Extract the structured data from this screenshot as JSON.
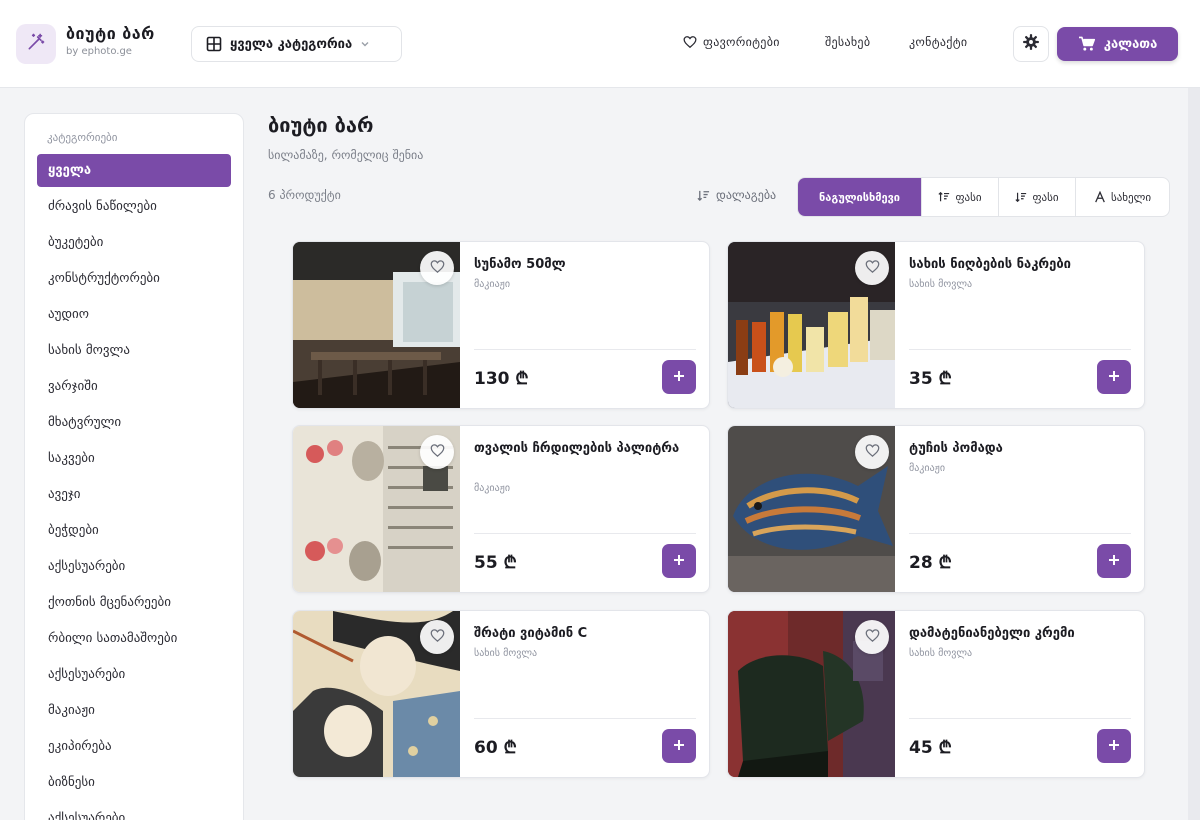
{
  "header": {
    "logo_icon": "magic-wand-icon",
    "title": "ბიუტი ბარ",
    "subtitle": "by ephoto.ge",
    "category_select": "ყველა კატეგორია",
    "nav": {
      "favorites": "ფავორიტები",
      "about": "შესახებ",
      "contact": "კონტაქტი"
    },
    "cart_label": "კალათა"
  },
  "sidebar": {
    "heading": "კატეგორიები",
    "items": [
      {
        "label": "ყველა",
        "active": true
      },
      {
        "label": "ძრავის ნაწილები"
      },
      {
        "label": "ბუკეტები"
      },
      {
        "label": "კონსტრუქტორები"
      },
      {
        "label": "აუდიო"
      },
      {
        "label": "სახის მოვლა"
      },
      {
        "label": "ვარჯიში"
      },
      {
        "label": "მხატვრული"
      },
      {
        "label": "საკვები"
      },
      {
        "label": "ავეჯი"
      },
      {
        "label": "ბეჭდები"
      },
      {
        "label": "აქსესუარები"
      },
      {
        "label": "ქოთნის მცენარეები"
      },
      {
        "label": "რბილი სათამაშოები"
      },
      {
        "label": "აქსესუარები"
      },
      {
        "label": "მაკიაჟი"
      },
      {
        "label": "ეკიპირება"
      },
      {
        "label": "ბიზნესი"
      },
      {
        "label": "აქსესუარები"
      }
    ]
  },
  "main": {
    "title": "ბიუტი ბარ",
    "subtitle": "სილამაზე, რომელიც შენია",
    "count": "6 პროდუქტი",
    "sort_label": "დალაგება",
    "sort_options": [
      {
        "label": "ნაგულისხმევი",
        "active": true
      },
      {
        "label": "ფასი",
        "icon": "sort-ascending-icon"
      },
      {
        "label": "ფასი",
        "icon": "sort-descending-icon"
      },
      {
        "label": "სახელი",
        "icon": "sort-alpha-icon"
      }
    ]
  },
  "products": [
    {
      "name": "სუნამო 50მლ",
      "category": "მაკიაჟი",
      "price": "130 ₾"
    },
    {
      "name": "სახის ნიღბების ნაკრები",
      "category": "სახის მოვლა",
      "price": "35 ₾"
    },
    {
      "name": "თვალის ჩრდილების პალიტრა",
      "category": "მაკიაჟი",
      "price": "55 ₾"
    },
    {
      "name": "ტუჩის პომადა",
      "category": "მაკიაჟი",
      "price": "28 ₾"
    },
    {
      "name": "შრატი ვიტამინ C",
      "category": "სახის მოვლა",
      "price": "60 ₾"
    },
    {
      "name": "დამატენიანებელი კრემი",
      "category": "სახის მოვლა",
      "price": "45 ₾"
    }
  ],
  "colors": {
    "accent": "#7a4ba8",
    "background": "#f3f4f6"
  }
}
